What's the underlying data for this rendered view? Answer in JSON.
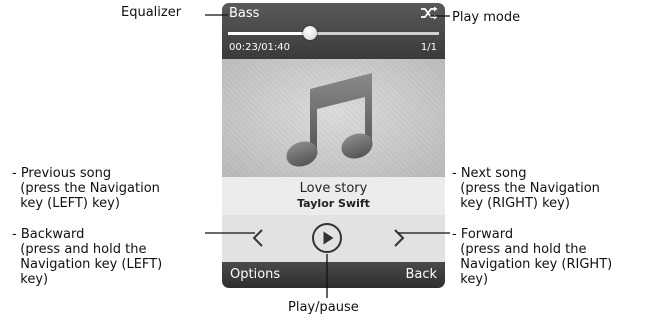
{
  "callouts": {
    "equalizer": "Equalizer",
    "play_mode": "Play mode",
    "previous": "- Previous song\n  (press the Navigation\n  key (LEFT) key)",
    "backward": "- Backward\n  (press and hold the\n  Navigation key (LEFT)\n  key)",
    "next": "- Next song\n  (press the Navigation\n  key (RIGHT) key)",
    "forward": "- Forward\n  (press and hold the\n  Navigation key (RIGHT)\n  key)",
    "play_pause": "Play/pause"
  },
  "player": {
    "equalizer_value": "Bass",
    "play_mode_icon": "shuffle-icon",
    "elapsed_time": "00:23/01:40",
    "track_count": "1/1",
    "progress_fraction": 0.39,
    "album_art_icon": "music-note-icon",
    "song_title": "Love story",
    "artist": "Taylor Swift",
    "softkey_left": "Options",
    "softkey_right": "Back"
  },
  "colors": {
    "bar_dark": "#3a3a3a",
    "panel_light": "#e6e6e6",
    "text_dark": "#111111"
  }
}
